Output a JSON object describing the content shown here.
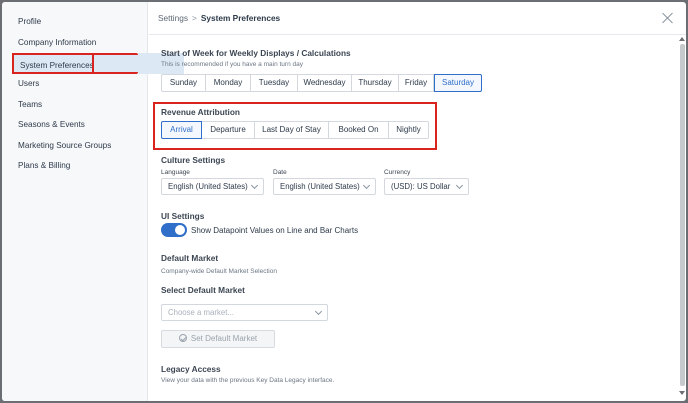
{
  "sidebar": {
    "items": [
      {
        "label": "Profile"
      },
      {
        "label": "Company Information"
      },
      {
        "label": "System Preferences",
        "active": true
      },
      {
        "label": "Users"
      },
      {
        "label": "Teams"
      },
      {
        "label": "Seasons & Events"
      },
      {
        "label": "Marketing Source Groups"
      },
      {
        "label": "Plans & Billing"
      }
    ]
  },
  "header": {
    "breadcrumb_root": "Settings",
    "breadcrumb_separator": ">",
    "breadcrumb_current": "System Preferences"
  },
  "week_start": {
    "title": "Start of Week for Weekly Displays / Calculations",
    "hint": "This is recommended if you have a main turn day",
    "options": [
      "Sunday",
      "Monday",
      "Tuesday",
      "Wednesday",
      "Thursday",
      "Friday",
      "Saturday"
    ],
    "selected": "Saturday"
  },
  "revenue_attribution": {
    "title": "Revenue Attribution",
    "options": [
      "Arrival",
      "Departure",
      "Last Day of Stay",
      "Booked On",
      "Nightly"
    ],
    "selected": "Arrival"
  },
  "culture": {
    "title": "Culture Settings",
    "language_label": "Language",
    "language_value": "English (United States)",
    "date_label": "Date",
    "date_value": "English (United States)",
    "currency_label": "Currency",
    "currency_value": "(USD): US Dollar"
  },
  "ui_settings": {
    "title": "UI Settings",
    "toggle_label": "Show Datapoint Values on Line and Bar Charts",
    "toggle_on": true
  },
  "default_market": {
    "title": "Default Market",
    "hint": "Company-wide Default Market Selection",
    "select_title": "Select Default Market",
    "placeholder": "Choose a market...",
    "button_label": "Set Default Market"
  },
  "legacy": {
    "title": "Legacy Access",
    "hint": "View your data with the previous Key Data Legacy interface."
  },
  "colors": {
    "accent": "#2f6ec9",
    "highlight": "#d9231e"
  }
}
